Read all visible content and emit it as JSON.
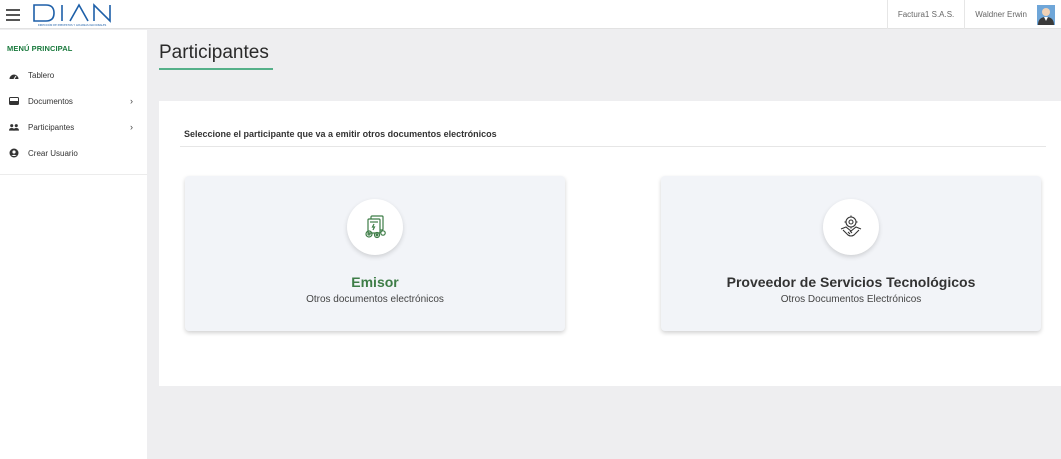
{
  "header": {
    "logo_text": "DIAN",
    "logo_tagline": "DIRECCIÓN DE IMPUESTOS Y ADUANAS NACIONALES",
    "company": "Factura1 S.A.S.",
    "user": "Waldner Erwin"
  },
  "sidebar": {
    "title": "MENÚ PRINCIPAL",
    "items": [
      {
        "label": "Tablero",
        "icon": "dashboard-icon"
      },
      {
        "label": "Documentos",
        "icon": "inbox-icon",
        "chevron": "›"
      },
      {
        "label": "Participantes",
        "icon": "users-icon",
        "chevron": "›"
      },
      {
        "label": "Crear Usuario",
        "icon": "user-circle-icon"
      }
    ]
  },
  "main": {
    "title": "Participantes",
    "prompt": "Seleccione el participante que va a emitir otros documentos electrónicos",
    "cards": [
      {
        "title": "Emisor",
        "subtitle": "Otros documentos electrónicos",
        "icon": "document-gears-icon"
      },
      {
        "title": "Proveedor de Servicios Tecnológicos",
        "subtitle": "Otros Documentos Electrónicos",
        "icon": "handshake-gear-icon"
      }
    ]
  },
  "colors": {
    "accent_green": "#55b089",
    "title_green": "#3e7d47",
    "logo_blue": "#1d5fa8"
  }
}
